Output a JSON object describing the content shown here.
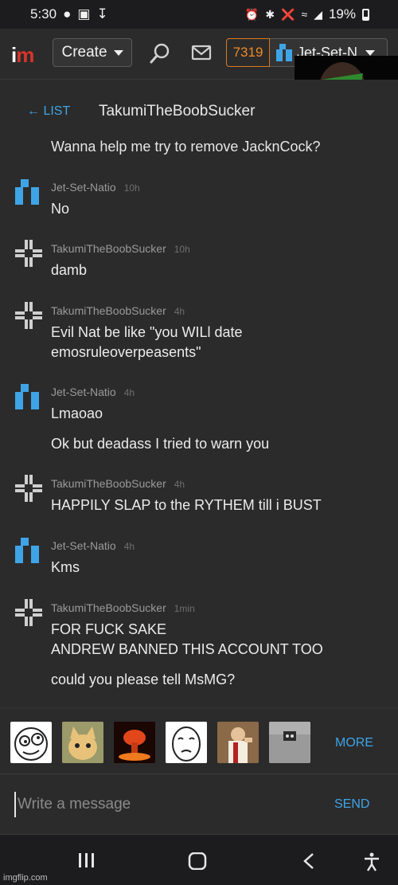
{
  "status_bar": {
    "time": "5:30",
    "battery": "19%"
  },
  "nav": {
    "logo_i": "i",
    "logo_m": "m",
    "create_label": "Create",
    "points": "7319",
    "username": "Jet-Set-N"
  },
  "conversation": {
    "back_label": "← LIST",
    "title": "TakumiTheBoobSucker",
    "partial_message": "Wanna help me try to remove JacknCock?",
    "messages": [
      {
        "author": "Jet-Set-Natio",
        "time": "10h",
        "lines": [
          "No"
        ]
      },
      {
        "author": "TakumiTheBoobSucker",
        "time": "10h",
        "lines": [
          "damb"
        ]
      },
      {
        "author": "TakumiTheBoobSucker",
        "time": "4h",
        "lines": [
          "Evil Nat be like \"you WILl date\nemosruleoverpeasents\""
        ]
      },
      {
        "author": "Jet-Set-Natio",
        "time": "4h",
        "lines": [
          "Lmaoao",
          "Ok but deadass I tried to warn you"
        ]
      },
      {
        "author": "TakumiTheBoobSucker",
        "time": "4h",
        "lines": [
          "HAPPILY SLAP to the RYTHEM till i BUST"
        ]
      },
      {
        "author": "Jet-Set-Natio",
        "time": "4h",
        "lines": [
          "Kms"
        ]
      },
      {
        "author": "TakumiTheBoobSucker",
        "time": "1min",
        "lines": [
          "FOR FUCK SAKE\nANDREW BANNED THIS ACCOUNT TOO",
          "could you please tell MsMG?"
        ]
      }
    ]
  },
  "emoji_bar": {
    "more_label": "MORE"
  },
  "composer": {
    "placeholder": "Write a message",
    "send_label": "SEND"
  },
  "watermark": "imgflip.com",
  "colors": {
    "accent": "#3fa4e6",
    "points": "#f08a24",
    "logo_m": "#d9352d",
    "background": "#2b2b2b"
  }
}
